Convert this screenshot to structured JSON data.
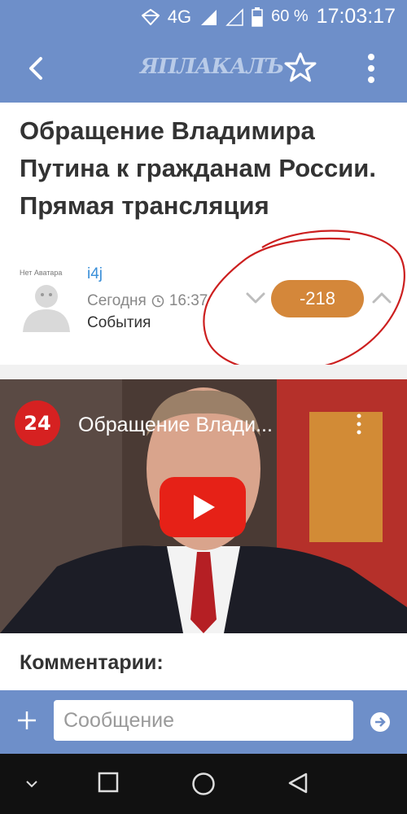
{
  "status_bar": {
    "network": "4G",
    "battery": "60 %",
    "time": "17:03:17"
  },
  "app_bar": {
    "logo_text": "ЯПЛАКАЛЪ"
  },
  "post": {
    "title": "Обращение Владимира Путина к гражданам России. Прямая трансляция",
    "avatar_caption": "Нет Аватара",
    "author": "i4j",
    "date": "Сегодня",
    "time": "16:37",
    "category": "События",
    "rating": "-218"
  },
  "video": {
    "channel_logo": "24",
    "title": "Обращение Влади..."
  },
  "comments": {
    "heading": "Комментарии:"
  },
  "composer": {
    "placeholder": "Сообщение"
  },
  "colors": {
    "header": "#6e8fc9",
    "rating_badge": "#d4873a",
    "author_link": "#3a8fd8",
    "annotation": "#cc1f1f"
  }
}
